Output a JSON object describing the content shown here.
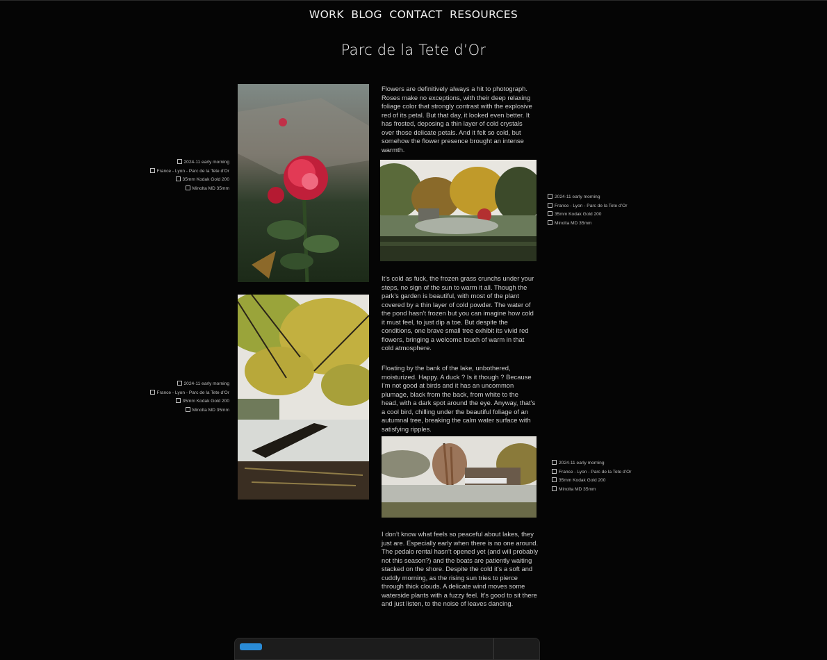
{
  "nav": {
    "items": [
      "WORK",
      "BLOG",
      "CONTACT",
      "RESOURCES"
    ]
  },
  "post": {
    "title": "Parc de la Tete d’Or"
  },
  "meta": {
    "date": "2024-11 early morning",
    "location": "France - Lyon - Parc de la Tete d’Or",
    "film": "35mm Kodak Gold 200",
    "camera": "Minolta MD 35mm"
  },
  "paragraphs": [
    "Flowers are definitively always a hit to photograph. Roses make no  exceptions, with their deep relaxing foliage color that strongly  contrast with the explosive red of its petal. But that day, it looked  even better. It has frosted, deposing a thin layer of cold crystals over those delicate petals. And it felt so cold, but somehow the flower  presence brought an intense warmth.",
    "It’s cold as fuck, the frozen grass crunchs under your steps, no sign of the sun to warm it all. Though the park’s garden is beautiful, with  most of the plant covered by a thin layer of cold powder. The water of the pond hasn’t frozen but you can imagine how cold it must feel, to  just dip a toe. But despite the conditions, one brave small tree exhibit its vivid red flowers, bringing a welcome touch of warm in that cold  atmosphere.",
    "Floating by the bank of the lake, unbothered, moisturized. Happy. A duck ? Is it though ? Because I’m not good at birds and it has an uncommon  plumage, black from the back, from white to the head, with a dark spot  around the eye. Anyway, that’s a cool bird, chilling under the beautiful foliage of an autumnal tree, breaking the calm water surface with  satisfying ripples.",
    "I don’t know what feels so peaceful about lakes, they just are.  Especially early when there is no one around. The pedalo rental hasn’t  opened yet (and will probably not this season?) and the boats are  patiently waiting stacked on the shore. Despite the cold it’s a soft and cuddly morning, as the rising sun tries to pierce through thick clouds. A delicate wind moves some waterside plants with a fuzzy feel. It’s  good to sit there and just listen, to the noise of leaves dancing."
  ],
  "photos": {
    "rose": "frosted-rose-photo",
    "garden": "frozen-garden-pond-photo",
    "tree": "autumn-tree-lake-photo",
    "lake": "lake-boathouse-photo"
  },
  "colors": {
    "background": "#050505",
    "text": "#d0d0d0",
    "accent": "#2a8bd6"
  }
}
